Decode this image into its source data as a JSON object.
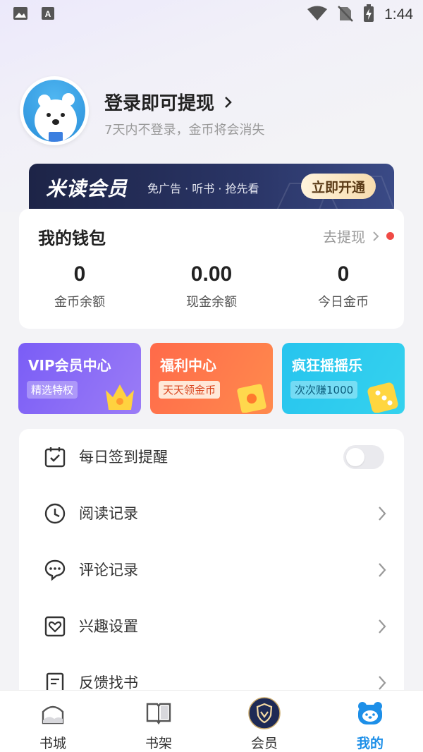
{
  "status_bar": {
    "time": "1:44"
  },
  "profile": {
    "login_title": "登录即可提现",
    "login_subtitle": "7天内不登录，金币将会消失"
  },
  "vip_banner": {
    "brand": "米读会员",
    "description": "免广告 · 听书 · 抢先看",
    "cta": "立即开通"
  },
  "wallet": {
    "title": "我的钱包",
    "withdraw_label": "去提现",
    "stats": [
      {
        "value": "0",
        "label": "金币余额"
      },
      {
        "value": "0.00",
        "label": "现金余额"
      },
      {
        "value": "0",
        "label": "今日金币"
      }
    ]
  },
  "features": [
    {
      "title": "VIP会员中心",
      "tag": "精选特权",
      "icon": "crown-icon"
    },
    {
      "title": "福利中心",
      "tag": "天天领金币",
      "icon": "red-envelope-icon"
    },
    {
      "title": "疯狂摇摇乐",
      "tag": "次次赚1000",
      "icon": "dice-icon"
    }
  ],
  "menu": [
    {
      "label": "每日签到提醒",
      "icon": "calendar-check-icon",
      "control": "toggle",
      "on": false
    },
    {
      "label": "阅读记录",
      "icon": "clock-icon",
      "control": "arrow"
    },
    {
      "label": "评论记录",
      "icon": "comment-icon",
      "control": "arrow"
    },
    {
      "label": "兴趣设置",
      "icon": "heart-icon",
      "control": "arrow"
    },
    {
      "label": "反馈找书",
      "icon": "document-icon",
      "control": "arrow"
    }
  ],
  "bottom_nav": [
    {
      "label": "书城",
      "icon": "home-icon"
    },
    {
      "label": "书架",
      "icon": "book-icon"
    },
    {
      "label": "会员",
      "icon": "vip-shield-icon"
    },
    {
      "label": "我的",
      "icon": "bear-icon",
      "active": true
    }
  ],
  "colors": {
    "accent": "#1d8fe8",
    "vip_purple": "#7a5df6",
    "welfare_orange": "#ff6a4a",
    "shake_cyan": "#27c4ee",
    "badge_red": "#f04a45"
  }
}
